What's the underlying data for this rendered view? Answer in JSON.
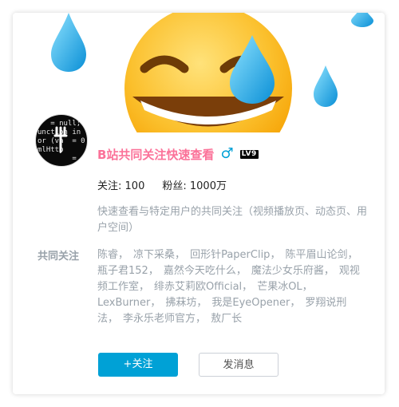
{
  "user": {
    "name": "B站共同关注快速查看",
    "gender_icon": "male-icon",
    "gender_glyph": "♂",
    "level": "LV9",
    "following_label": "关注:",
    "following": "100",
    "followers_label": "粉丝:",
    "followers": "1000万",
    "description": "快速查看与特定用户的共同关注（视频播放页、动态页、用户空间）",
    "avatar_code_text": "   = null;\nunction in\nor (va  = 0\nmlHttp\n        ="
  },
  "common": {
    "label": "共同关注",
    "users": [
      "陈睿",
      "凉下采桑",
      "回形针PaperClip",
      "陈平眉山论剑",
      "瓶子君152",
      "嘉然今天吃什么",
      "魔法少女乐府酱",
      "观视频工作室",
      "绯赤艾莉欧Official",
      "芒果冰OL",
      "LexBurner",
      "拂菻坊",
      "我是EyeOpener",
      "罗翔说刑法",
      "李永乐老师官方",
      "敖厂长"
    ]
  },
  "actions": {
    "follow_label": "+关注",
    "message_label": "发消息"
  },
  "colors": {
    "name_pink": "#fb7299",
    "brand_blue": "#00a1d6",
    "muted_text": "#99a2aa"
  }
}
